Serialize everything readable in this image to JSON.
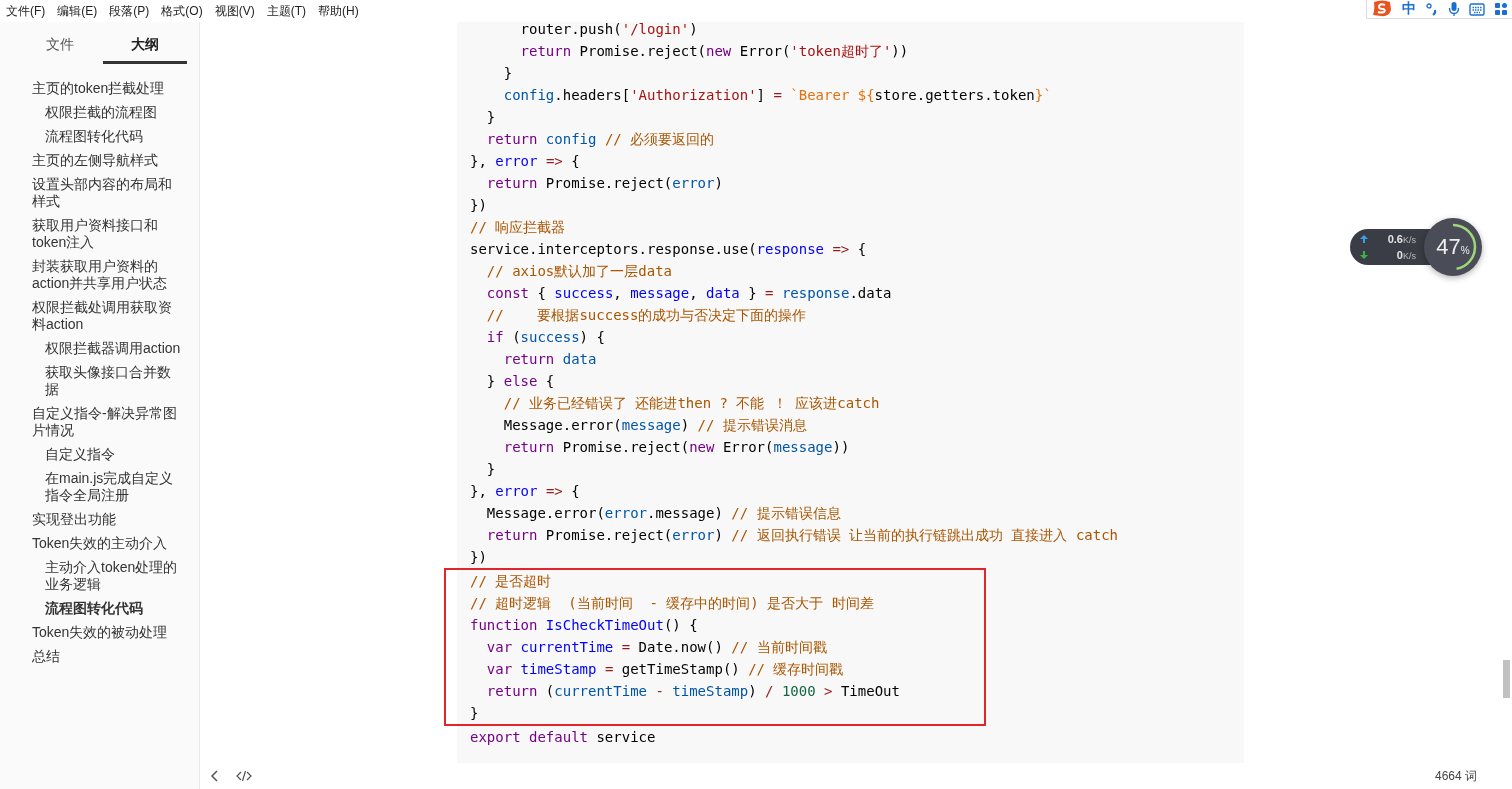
{
  "menu_bar": [
    "文件(F)",
    "编辑(E)",
    "段落(P)",
    "格式(O)",
    "视图(V)",
    "主题(T)",
    "帮助(H)"
  ],
  "sidebar": {
    "tabs": [
      {
        "label": "文件",
        "selected": false
      },
      {
        "label": "大纲",
        "selected": true
      }
    ],
    "outline": [
      {
        "text": "主页的token拦截处理",
        "selected": false,
        "children": [
          {
            "text": "权限拦截的流程图",
            "selected": false
          },
          {
            "text": "流程图转化代码",
            "selected": false
          }
        ]
      },
      {
        "text": "主页的左侧导航样式",
        "selected": false
      },
      {
        "text": "设置头部内容的布局和样式",
        "selected": false
      },
      {
        "text": "获取用户资料接口和token注入",
        "selected": false
      },
      {
        "text": "封装获取用户资料的action并共享用户状态",
        "selected": false
      },
      {
        "text": "权限拦截处调用获取资料action",
        "selected": false,
        "children": [
          {
            "text": "权限拦截器调用action",
            "selected": false
          },
          {
            "text": "获取头像接口合并数据",
            "selected": false
          }
        ]
      },
      {
        "text": "自定义指令-解决异常图片情况",
        "selected": false,
        "children": [
          {
            "text": "自定义指令",
            "selected": false
          },
          {
            "text": "在main.js完成自定义指令全局注册",
            "selected": false
          }
        ]
      },
      {
        "text": "实现登出功能",
        "selected": false
      },
      {
        "text": "Token失效的主动介入",
        "selected": false,
        "children": [
          {
            "text": "主动介入token处理的业务逻辑",
            "selected": false
          },
          {
            "text": "流程图转化代码",
            "selected": true
          }
        ]
      },
      {
        "text": "Token失效的被动处理",
        "selected": false
      },
      {
        "text": "总结",
        "selected": false
      }
    ]
  },
  "code": {
    "sections": [
      {
        "highlighted": false,
        "lines": [
          [
            {
              "kind": "plain",
              "text": "      router.push("
            },
            {
              "kind": "string",
              "text": "'/login'"
            },
            {
              "kind": "plain",
              "text": ")"
            }
          ],
          [
            {
              "kind": "keyword",
              "text": "      return"
            },
            {
              "kind": "plain",
              "text": " Promise.reject("
            },
            {
              "kind": "keyword",
              "text": "new"
            },
            {
              "kind": "plain",
              "text": " Error("
            },
            {
              "kind": "string",
              "text": "'token超时了'"
            },
            {
              "kind": "plain",
              "text": "))"
            }
          ],
          [
            {
              "kind": "plain",
              "text": "    }"
            }
          ],
          [
            {
              "kind": "variable",
              "text": "    config"
            },
            {
              "kind": "plain",
              "text": ".headers["
            },
            {
              "kind": "string",
              "text": "'Authorization'"
            },
            {
              "kind": "plain",
              "text": "] "
            },
            {
              "kind": "operator",
              "text": "="
            },
            {
              "kind": "template",
              "text": " `Bearer ${"
            },
            {
              "kind": "plain",
              "text": "store.getters.token"
            },
            {
              "kind": "template",
              "text": "}`"
            }
          ],
          [
            {
              "kind": "plain",
              "text": "  }"
            }
          ],
          [
            {
              "kind": "keyword",
              "text": "  return"
            },
            {
              "kind": "variable",
              "text": " config"
            },
            {
              "kind": "comment",
              "text": " // 必须要返回的"
            }
          ],
          [
            {
              "kind": "plain",
              "text": "}, "
            },
            {
              "kind": "definition",
              "text": "error"
            },
            {
              "kind": "operator",
              "text": " =>"
            },
            {
              "kind": "plain",
              "text": " {"
            }
          ],
          [
            {
              "kind": "keyword",
              "text": "  return"
            },
            {
              "kind": "plain",
              "text": " Promise.reject("
            },
            {
              "kind": "variable",
              "text": "error"
            },
            {
              "kind": "plain",
              "text": ")"
            }
          ],
          [
            {
              "kind": "plain",
              "text": "})"
            }
          ],
          [
            {
              "kind": "comment",
              "text": "// 响应拦截器"
            }
          ],
          [
            {
              "kind": "plain",
              "text": "service.interceptors.response.use("
            },
            {
              "kind": "definition",
              "text": "response"
            },
            {
              "kind": "operator",
              "text": " =>"
            },
            {
              "kind": "plain",
              "text": " {"
            }
          ],
          [
            {
              "kind": "comment",
              "text": "  // axios默认加了一层data"
            }
          ],
          [
            {
              "kind": "keyword",
              "text": "  const"
            },
            {
              "kind": "plain",
              "text": " { "
            },
            {
              "kind": "definition",
              "text": "success"
            },
            {
              "kind": "plain",
              "text": ", "
            },
            {
              "kind": "definition",
              "text": "message"
            },
            {
              "kind": "plain",
              "text": ", "
            },
            {
              "kind": "definition",
              "text": "data"
            },
            {
              "kind": "plain",
              "text": " } "
            },
            {
              "kind": "operator",
              "text": "="
            },
            {
              "kind": "variable",
              "text": " response"
            },
            {
              "kind": "plain",
              "text": ".data"
            }
          ],
          [
            {
              "kind": "comment",
              "text": "  //    要根据success的成功与否决定下面的操作"
            }
          ],
          [
            {
              "kind": "keyword",
              "text": "  if"
            },
            {
              "kind": "plain",
              "text": " ("
            },
            {
              "kind": "variable",
              "text": "success"
            },
            {
              "kind": "plain",
              "text": ") {"
            }
          ],
          [
            {
              "kind": "keyword",
              "text": "    return"
            },
            {
              "kind": "variable",
              "text": " data"
            }
          ],
          [
            {
              "kind": "plain",
              "text": "  } "
            },
            {
              "kind": "keyword",
              "text": "else"
            },
            {
              "kind": "plain",
              "text": " {"
            }
          ],
          [
            {
              "kind": "comment",
              "text": "    // 业务已经错误了 还能进then ? 不能 ！ 应该进catch"
            }
          ],
          [
            {
              "kind": "plain",
              "text": "    Message.error("
            },
            {
              "kind": "variable",
              "text": "message"
            },
            {
              "kind": "plain",
              "text": ") "
            },
            {
              "kind": "comment",
              "text": "// 提示错误消息"
            }
          ],
          [
            {
              "kind": "keyword",
              "text": "    return"
            },
            {
              "kind": "plain",
              "text": " Promise.reject("
            },
            {
              "kind": "keyword",
              "text": "new"
            },
            {
              "kind": "plain",
              "text": " Error("
            },
            {
              "kind": "variable",
              "text": "message"
            },
            {
              "kind": "plain",
              "text": "))"
            }
          ],
          [
            {
              "kind": "plain",
              "text": "  }"
            }
          ],
          [
            {
              "kind": "plain",
              "text": "}, "
            },
            {
              "kind": "definition",
              "text": "error"
            },
            {
              "kind": "operator",
              "text": " =>"
            },
            {
              "kind": "plain",
              "text": " {"
            }
          ],
          [
            {
              "kind": "plain",
              "text": "  Message.error("
            },
            {
              "kind": "variable",
              "text": "error"
            },
            {
              "kind": "plain",
              "text": ".message) "
            },
            {
              "kind": "comment",
              "text": "// 提示错误信息"
            }
          ],
          [
            {
              "kind": "keyword",
              "text": "  return"
            },
            {
              "kind": "plain",
              "text": " Promise.reject("
            },
            {
              "kind": "variable",
              "text": "error"
            },
            {
              "kind": "plain",
              "text": ") "
            },
            {
              "kind": "comment",
              "text": "// 返回执行错误 让当前的执行链跳出成功 直接进入 catch"
            }
          ],
          [
            {
              "kind": "plain",
              "text": "})"
            }
          ]
        ]
      },
      {
        "highlighted": true,
        "lines": [
          [
            {
              "kind": "comment",
              "text": "// 是否超时"
            }
          ],
          [
            {
              "kind": "comment",
              "text": "// 超时逻辑  (当前时间  - 缓存中的时间) 是否大于 时间差"
            }
          ],
          [
            {
              "kind": "keyword",
              "text": "function"
            },
            {
              "kind": "definition",
              "text": " IsCheckTimeOut"
            },
            {
              "kind": "plain",
              "text": "() {"
            }
          ],
          [
            {
              "kind": "keyword",
              "text": "  var"
            },
            {
              "kind": "definition",
              "text": " currentTime"
            },
            {
              "kind": "operator",
              "text": " ="
            },
            {
              "kind": "plain",
              "text": " Date.now() "
            },
            {
              "kind": "comment",
              "text": "// 当前时间戳"
            }
          ],
          [
            {
              "kind": "keyword",
              "text": "  var"
            },
            {
              "kind": "definition",
              "text": " timeStamp"
            },
            {
              "kind": "operator",
              "text": " ="
            },
            {
              "kind": "plain",
              "text": " getTimeStamp() "
            },
            {
              "kind": "comment",
              "text": "// 缓存时间戳"
            }
          ],
          [
            {
              "kind": "keyword",
              "text": "  return"
            },
            {
              "kind": "plain",
              "text": " ("
            },
            {
              "kind": "variable",
              "text": "currentTime"
            },
            {
              "kind": "operator",
              "text": " -"
            },
            {
              "kind": "variable",
              "text": " timeStamp"
            },
            {
              "kind": "plain",
              "text": ") "
            },
            {
              "kind": "operator",
              "text": "/"
            },
            {
              "kind": "number",
              "text": " 1000"
            },
            {
              "kind": "operator",
              "text": " >"
            },
            {
              "kind": "plain",
              "text": " TimeOut"
            }
          ],
          [
            {
              "kind": "plain",
              "text": "}"
            }
          ]
        ]
      },
      {
        "highlighted": false,
        "lines": [
          [
            {
              "kind": "keyword",
              "text": "export"
            },
            {
              "kind": "keyword",
              "text": " default"
            },
            {
              "kind": "plain",
              "text": " service"
            }
          ]
        ]
      }
    ]
  },
  "status_bar": {
    "word_count": "4664 词"
  },
  "ime_toolbar": {
    "mode": "中"
  },
  "network_widget": {
    "upload": {
      "value": "0.6",
      "unit": "K/s"
    },
    "download": {
      "value": "0",
      "unit": "K/s"
    },
    "usage": {
      "value": "47",
      "unit": "%",
      "level": 0.47
    }
  }
}
